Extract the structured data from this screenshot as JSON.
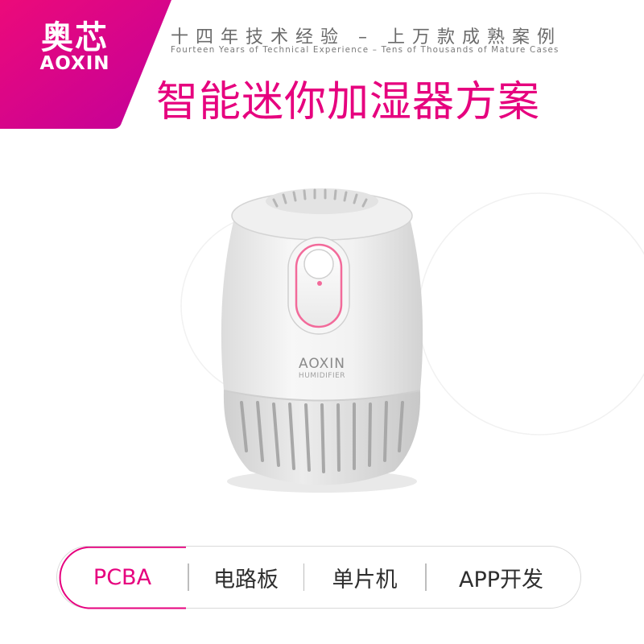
{
  "logo": {
    "name_cn": "奥芯",
    "name_en": "AOXIN",
    "badge_gradient": [
      "#e6007e",
      "#c40095"
    ]
  },
  "tagline": {
    "cn": "十四年技术经验 – 上万款成熟案例",
    "en": "Fourteen Years of Technical Experience – Tens of Thousands of Mature Cases"
  },
  "headline": "智能迷你加湿器方案",
  "product": {
    "brand": "AOXIN",
    "model": "HUMIDIFIER",
    "indicator_color": "#f26a9a"
  },
  "tabs": [
    {
      "label": "PCBA",
      "active": true
    },
    {
      "label": "电路板",
      "active": false
    },
    {
      "label": "单片机",
      "active": false
    },
    {
      "label": "APP开发",
      "active": false
    }
  ],
  "colors": {
    "accent": "#e6007e",
    "text": "#2e2e2e",
    "muted": "#6b6b6b"
  }
}
